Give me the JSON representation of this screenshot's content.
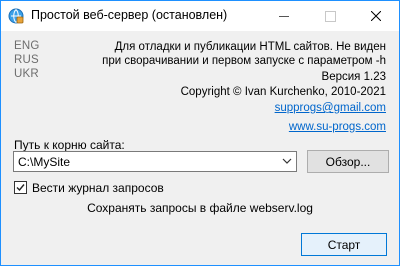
{
  "window": {
    "title": "Простой веб-сервер  (остановлен)",
    "icon": "server-app-icon"
  },
  "languages": [
    "ENG",
    "RUS",
    "UKR"
  ],
  "about": {
    "description_line1": "Для отладки и публикации HTML сайтов. Не виден",
    "description_line2": "при сворачивании и первом запуске с параметром -h",
    "version": "Версия 1.23",
    "copyright": "Copyright © Ivan Kurchenko, 2010-2021",
    "email": "supprogs@gmail.com",
    "website": "www.su-progs.com"
  },
  "site_root": {
    "label": "Путь к корню сайта:",
    "value": "C:\\MySite",
    "browse_label": "Обзор..."
  },
  "logging": {
    "checkbox_label": "Вести журнал запросов",
    "checked": true,
    "file_note": "Сохранять запросы в файле webserv.log"
  },
  "actions": {
    "start_label": "Старт"
  },
  "colors": {
    "link": "#0066cc",
    "accent_border": "#0078d7",
    "muted_text": "#6d6d6d"
  }
}
